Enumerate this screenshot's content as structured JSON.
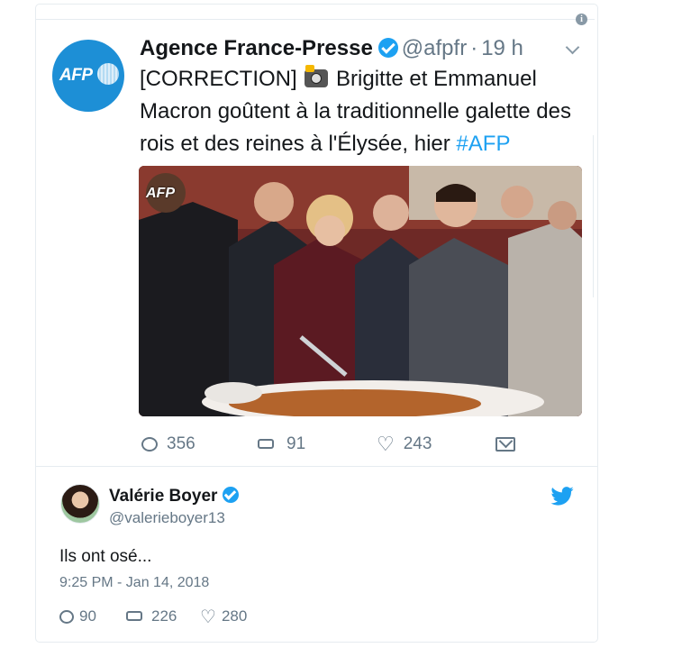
{
  "embedded_tweet": {
    "author_name": "Agence France-Presse",
    "handle": "@afpfr",
    "separator": "·",
    "time": "19 h",
    "avatar_text": "AFP",
    "text_before": "[CORRECTION] ",
    "text_after": " Brigitte et Emmanuel Macron goûtent à la traditionnelle galette des rois et des reines à l'Élysée, hier ",
    "hashtag": "#AFP",
    "photo_watermark": "AFP",
    "reply_count": "356",
    "retweet_count": "91",
    "like_count": "243"
  },
  "tweet": {
    "author_name": "Valérie Boyer",
    "handle": "@valerieboyer13",
    "text": "Ils ont osé...",
    "date": "9:25 PM - Jan 14, 2018",
    "reply_count": "90",
    "retweet_count": "226",
    "like_count": "280"
  },
  "colors": {
    "accent": "#1da1f2",
    "muted": "#657786",
    "afp_blue": "#1d8fd6"
  },
  "icons": [
    "info-icon",
    "verified-icon",
    "chevron-down-icon",
    "camera-emoji-icon",
    "reply-icon",
    "retweet-icon",
    "heart-icon",
    "message-icon",
    "twitter-bird-icon"
  ]
}
